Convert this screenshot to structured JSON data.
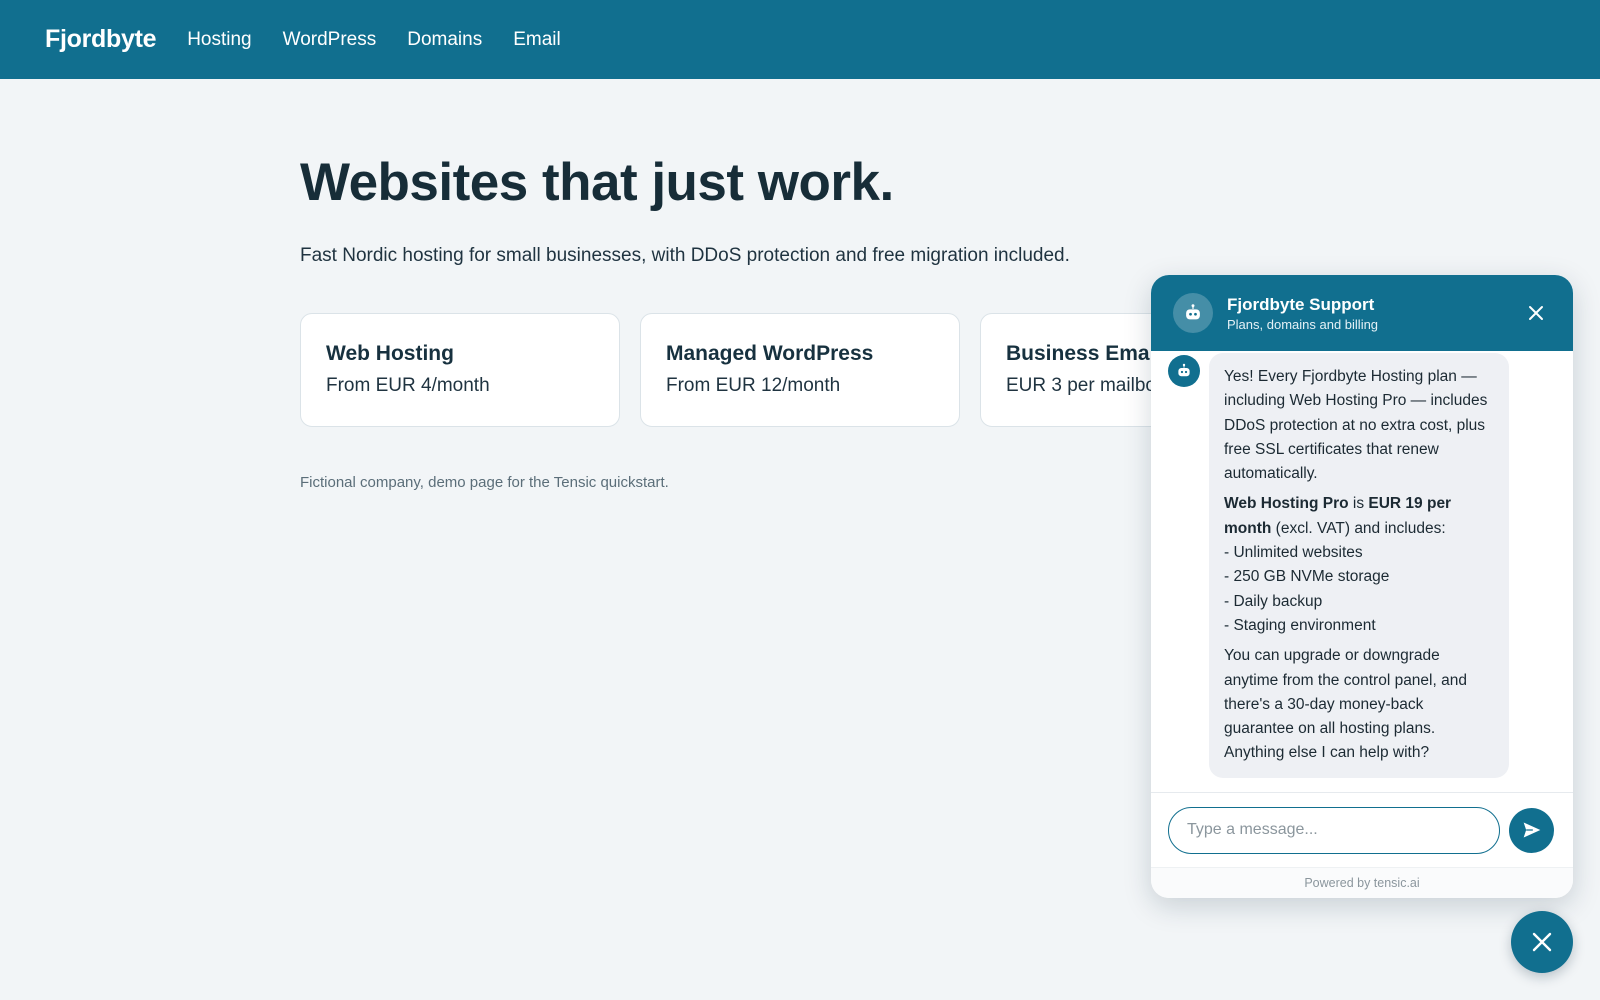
{
  "nav": {
    "brand": "Fjordbyte",
    "links": [
      "Hosting",
      "WordPress",
      "Domains",
      "Email"
    ]
  },
  "hero": {
    "title": "Websites that just work.",
    "subtitle": "Fast Nordic hosting for small businesses, with DDoS protection and free migration included."
  },
  "cards": [
    {
      "title": "Web Hosting",
      "price": "From EUR 4/month"
    },
    {
      "title": "Managed WordPress",
      "price": "From EUR 12/month"
    },
    {
      "title": "Business Email",
      "price": "EUR 3 per mailbox"
    }
  ],
  "footnote": "Fictional company, demo page for the Tensic quickstart.",
  "chat": {
    "title": "Fjordbyte Support",
    "subtitle": "Plans, domains and billing",
    "message": {
      "p1": "Yes! Every Fjordbyte Hosting plan — including Web Hosting Pro — includes DDoS protection at no extra cost, plus free SSL certificates that renew automatically.",
      "plan_name": "Web Hosting Pro",
      "is": " is ",
      "price": "EUR 19 per month",
      "price_suffix": " (excl. VAT) and includes:",
      "features": [
        "- Unlimited websites",
        "- 250 GB NVMe storage",
        "- Daily backup",
        "- Staging environment"
      ],
      "p3": "You can upgrade or downgrade anytime from the control panel, and there's a 30-day money-back guarantee on all hosting plans. Anything else I can help with?"
    },
    "input_placeholder": "Type a message...",
    "input_value": "",
    "powered_by": "Powered by tensic.ai"
  },
  "icons": {
    "bot": "robot-icon",
    "close": "close-icon",
    "send": "send-icon",
    "fab": "close-icon"
  },
  "colors": {
    "brand": "#116f8f",
    "background": "#f2f5f7",
    "bubble": "#eef0f4"
  }
}
